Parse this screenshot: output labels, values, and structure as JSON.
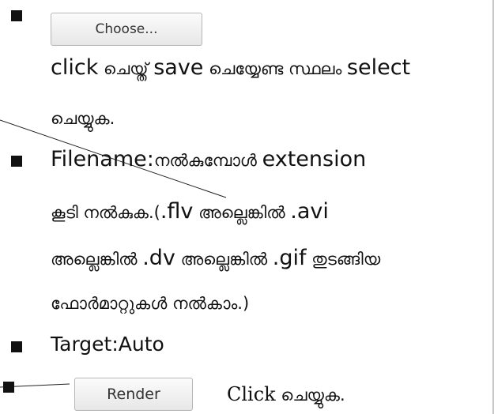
{
  "buttons": {
    "choose_label": "Choose...",
    "render_label": "Render"
  },
  "instructions": {
    "item1": {
      "part1": "click",
      "part2": " ചെയ്ത് ",
      "part3": "save",
      "part4": " ചെയ്യേണ്ട സ്ഥലം ",
      "part5": "select",
      "part6": "ചെയ്യുക."
    },
    "item2": {
      "label": "Filename:",
      "text1": "നൽകുമ്പോൾ ",
      "text2": " extension",
      "text3": "കൂടി നൽകുക.(",
      "ext_flv": ".flv",
      "text4": " അല്ലെങ്കിൽ ",
      "ext_avi": ".avi",
      "text5": "അല്ലെങ്കിൽ ",
      "ext_dv": ".dv",
      "text6": " അല്ലെങ്കിൽ ",
      "ext_gif": ".gif",
      "text7": " തുടങ്ങിയ",
      "text8": "ഫോർമാറ്റുകൾ നൽകാം.)"
    },
    "item3": {
      "text": "Target:Auto"
    },
    "item4": {
      "click": "Click",
      "rest": " ചെയ്യുക."
    }
  }
}
